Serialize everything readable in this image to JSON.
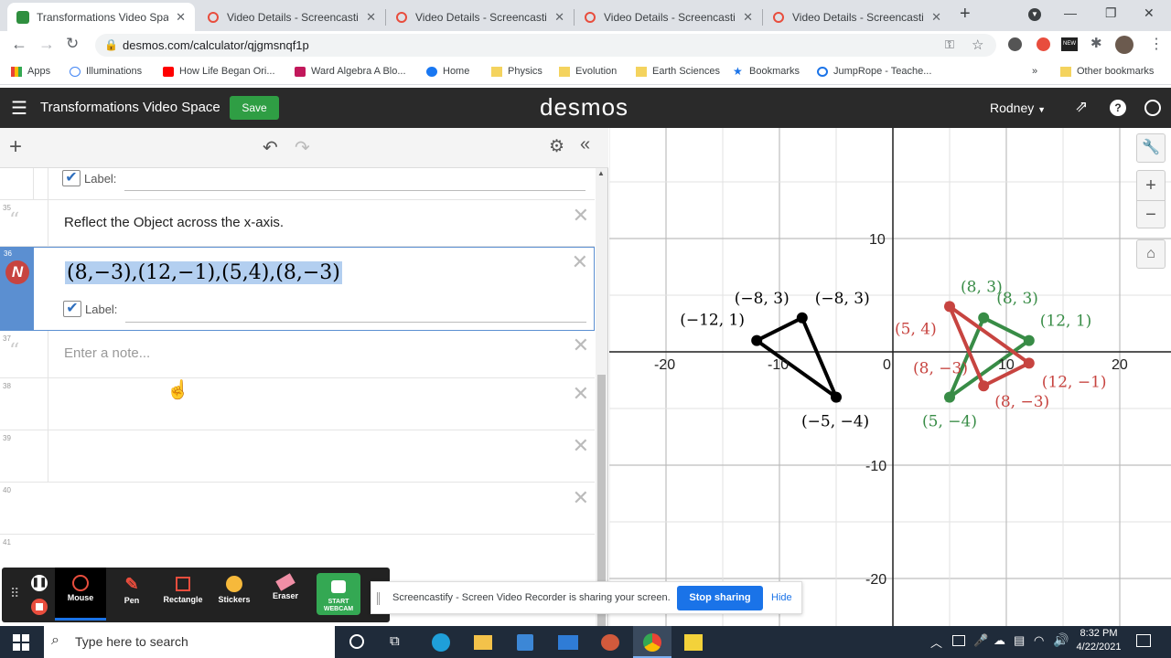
{
  "browser": {
    "tabs": [
      {
        "title": "Transformations Video Space",
        "active": true
      },
      {
        "title": "Video Details - Screencastify",
        "active": false
      },
      {
        "title": "Video Details - Screencastify",
        "active": false
      },
      {
        "title": "Video Details - Screencastify",
        "active": false
      },
      {
        "title": "Video Details - Screencastify",
        "active": false
      }
    ],
    "url": "desmos.com/calculator/qjgmsnqf1p",
    "bookmarks": [
      "Apps",
      "Illuminations",
      "How Life Began Ori...",
      "Ward Algebra A Blo...",
      "Home",
      "Physics",
      "Evolution",
      "Earth Sciences",
      "Bookmarks",
      "JumpRope - Teache..."
    ],
    "more": "»",
    "other_bookmarks": "Other bookmarks"
  },
  "desmos": {
    "title": "Transformations Video Space",
    "save_label": "Save",
    "logo": "desmos",
    "user": "Rodney",
    "rows": {
      "r34_label": "Label:",
      "r35_num": "35",
      "r35_text": "Reflect the Object across the x-axis.",
      "r36_num": "36",
      "r36_expr": "(8,−3),(12,−1),(5,4),(8,−3)",
      "r36_label": "Label:",
      "r37_num": "37",
      "r37_placeholder": "Enter a note...",
      "r38_num": "38",
      "r39_num": "39",
      "r40_num": "40",
      "r41_num": "41"
    },
    "axis_labels": {
      "xm20": "-20",
      "xm10": "-10",
      "x0": "0",
      "x10": "10",
      "x20": "20",
      "y10": "10",
      "ym10": "-10",
      "ym20": "-20"
    },
    "point_labels": {
      "black": [
        "(−8, 3)",
        "(−8, 3)",
        "(−12, 1)",
        "(−5, −4)"
      ],
      "green": [
        "(8, 3)",
        "(8, 3)",
        "(12, 1)",
        "(5, −4)"
      ],
      "red": [
        "(5, 4)",
        "(8, −3)",
        "(12, −1)",
        "(8, −3)"
      ]
    },
    "colors": {
      "black": "#000000",
      "green": "#388c46",
      "red": "#c74440"
    }
  },
  "screencastify": {
    "tools": [
      "Mouse",
      "Pen",
      "Rectangle",
      "Stickers",
      "Eraser"
    ],
    "webcam": "START WEBCAM",
    "share_text": "Screencastify - Screen Video Recorder is sharing your screen.",
    "stop_label": "Stop sharing",
    "hide_label": "Hide"
  },
  "taskbar": {
    "search_placeholder": "Type here to search",
    "time": "8:32 PM",
    "date": "4/22/2021"
  }
}
